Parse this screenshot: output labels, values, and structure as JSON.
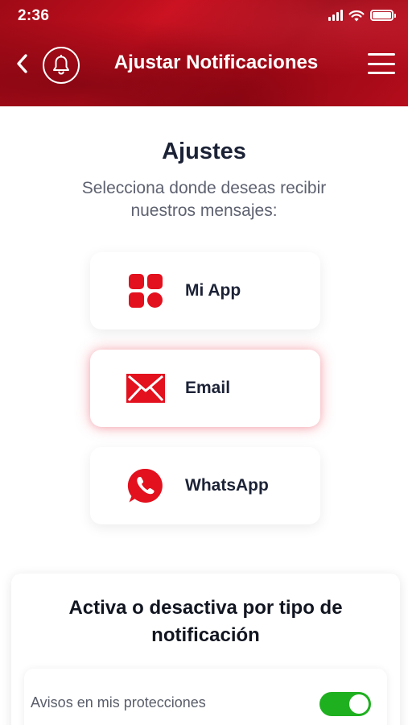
{
  "status_bar": {
    "time": "2:36",
    "icons": [
      "signal-icon",
      "wifi-icon",
      "battery-icon"
    ]
  },
  "nav": {
    "title": "Ajustar Notificaciones",
    "back_icon": "chevron-left-icon",
    "bell_icon": "bell-icon",
    "menu_icon": "hamburger-menu-icon"
  },
  "settings": {
    "title": "Ajustes",
    "subtitle": "Selecciona donde deseas recibir nuestros mensajes:",
    "channels": [
      {
        "label": "Mi App",
        "icon": "app-grid-icon",
        "selected": false
      },
      {
        "label": "Email",
        "icon": "envelope-icon",
        "selected": true
      },
      {
        "label": "WhatsApp",
        "icon": "whatsapp-icon",
        "selected": false
      }
    ]
  },
  "notification_types": {
    "title": "Activa o desactiva por tipo de notificación",
    "items": [
      {
        "label": "Avisos en mis protecciones",
        "enabled": true
      }
    ]
  },
  "colors": {
    "brand_red": "#e3101e",
    "header_red": "#b50d1c",
    "toggle_on": "#1fb01f",
    "text_dark": "#1c2236",
    "text_muted": "#5e6270"
  }
}
